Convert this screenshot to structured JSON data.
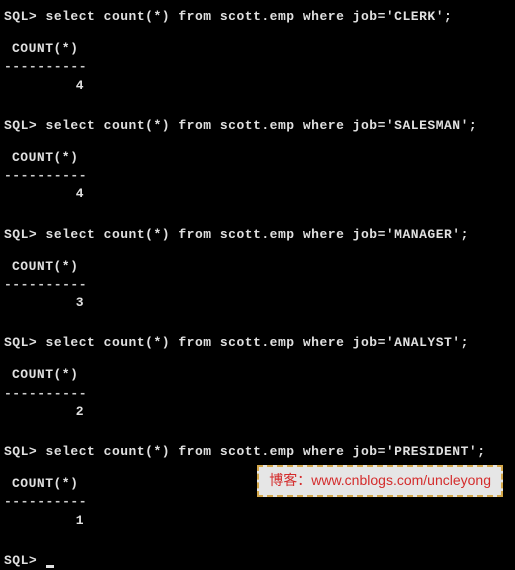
{
  "prompt": "SQL>",
  "column_header": "COUNT(*)",
  "divider": "----------",
  "queries": [
    {
      "sql": "select count(*) from scott.emp where job='CLERK';",
      "result": "4"
    },
    {
      "sql": "select count(*) from scott.emp where job='SALESMAN';",
      "result": "4"
    },
    {
      "sql": "select count(*) from scott.emp where job='MANAGER';",
      "result": "3"
    },
    {
      "sql": "select count(*) from scott.emp where job='ANALYST';",
      "result": "2"
    },
    {
      "sql": "select count(*) from scott.emp where job='PRESIDENT';",
      "result": "1"
    }
  ],
  "watermark": {
    "label": "博客：",
    "url": "www.cnblogs.com/uncleyong"
  }
}
